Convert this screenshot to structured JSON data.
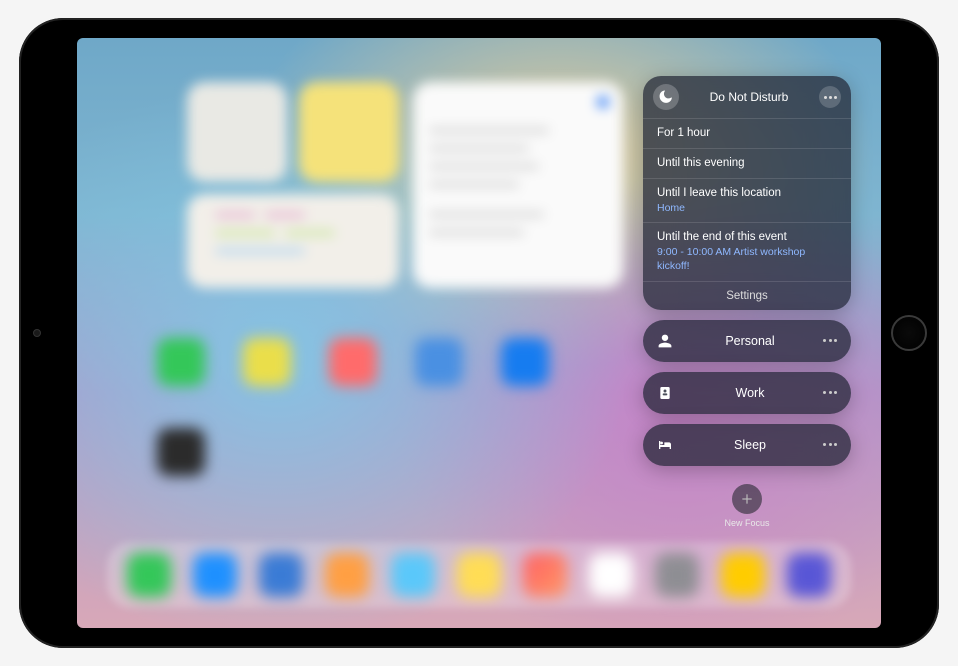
{
  "focus": {
    "dnd": {
      "title": "Do Not Disturb",
      "options": [
        {
          "label": "For 1 hour"
        },
        {
          "label": "Until this evening"
        },
        {
          "label": "Until I leave this location",
          "sub": "Home"
        },
        {
          "label": "Until the end of this event",
          "sub": "9:00 - 10:00 AM Artist workshop kickoff!"
        }
      ],
      "settings_label": "Settings"
    },
    "modes": [
      {
        "name": "Personal",
        "icon": "person"
      },
      {
        "name": "Work",
        "icon": "badge"
      },
      {
        "name": "Sleep",
        "icon": "bed"
      }
    ],
    "new_focus_label": "New Focus"
  }
}
